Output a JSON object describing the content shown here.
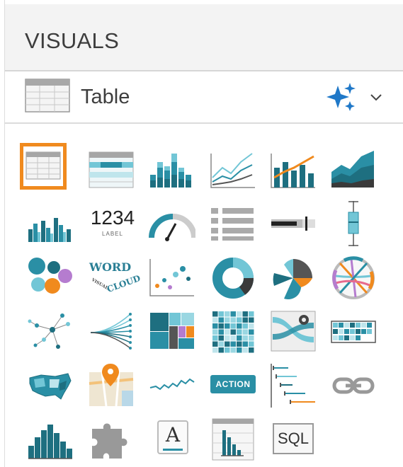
{
  "panel": {
    "title": "VISUALS"
  },
  "selector": {
    "label": "Table",
    "icon": "table-icon"
  },
  "grid": {
    "rows": [
      [
        "table",
        "cross-tabulation",
        "stacked-bar",
        "lines",
        "combo-bar-line",
        "area"
      ],
      [
        "grouped-bars",
        "kpi-label",
        "gauge",
        "list",
        "bullet",
        "box-plot"
      ],
      [
        "packed-bubbles",
        "word-cloud",
        "scatter",
        "pie-donut",
        "radial",
        "chord"
      ],
      [
        "network",
        "dendrogram",
        "treemap",
        "heatmap",
        "correlation-flow",
        "calendar-heatmap"
      ],
      [
        "map",
        "interactive-map",
        "sparklines",
        "action",
        "histogram-bars",
        "link"
      ],
      [
        "histogram",
        "extension",
        "rich-text",
        "table-bar",
        "sql"
      ]
    ],
    "selected": "table"
  },
  "labels": {
    "kpi_value": "1234",
    "kpi_sub": "LABEL",
    "word1": "WORD",
    "word2": "CLOUD",
    "word3": "VISUAL",
    "action": "ACTION",
    "sql": "SQL",
    "rich_text": "A"
  },
  "colors": {
    "accent": "#2a8fa5",
    "dark": "#1e6f80",
    "light": "#72c6d6",
    "orange": "#f08a1e",
    "selected_border": "#f08a1e"
  }
}
